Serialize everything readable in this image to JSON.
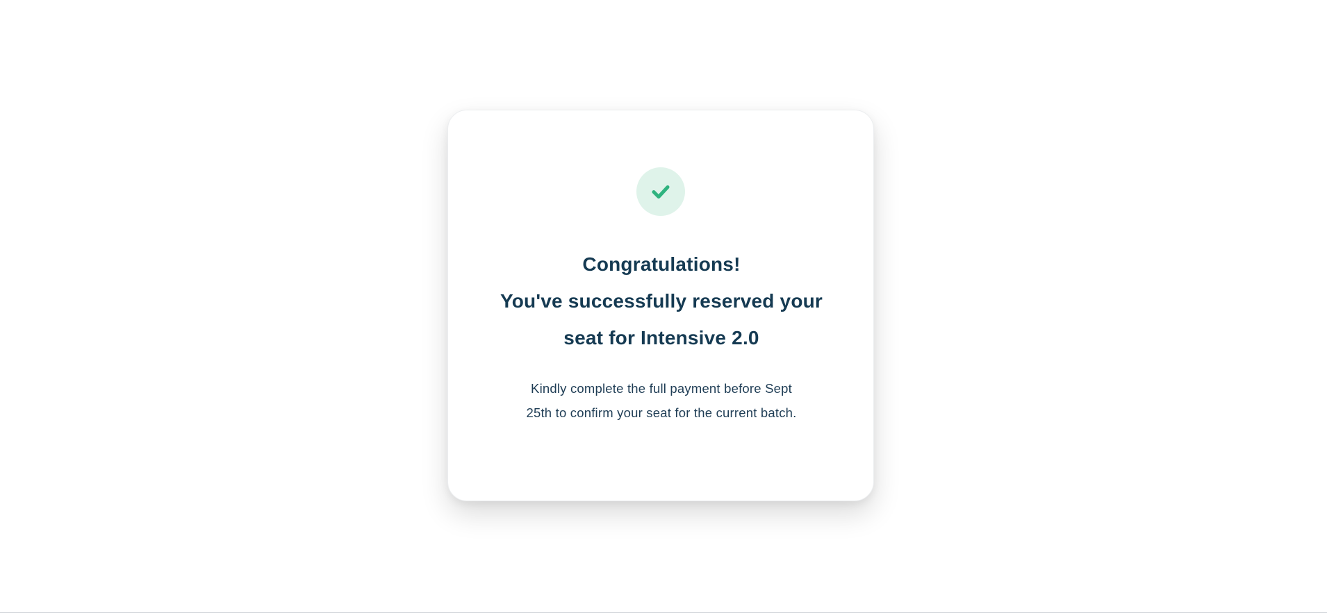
{
  "colors": {
    "background": "#ffffff",
    "card": "#ffffff",
    "heading_text": "#153a52",
    "body_text": "#1f3d55",
    "success_green": "#2fb37f",
    "success_tint": "#dff3ea"
  },
  "icons": {
    "status": "checkmark-icon"
  },
  "confirmation": {
    "heading_line1": "Congratulations!",
    "heading_line2": "You've successfully reserved your",
    "heading_line3": "seat for Intensive 2.0",
    "note_line1": "Kindly complete the full payment before Sept",
    "note_line2": "25th to confirm your seat for the current batch."
  }
}
